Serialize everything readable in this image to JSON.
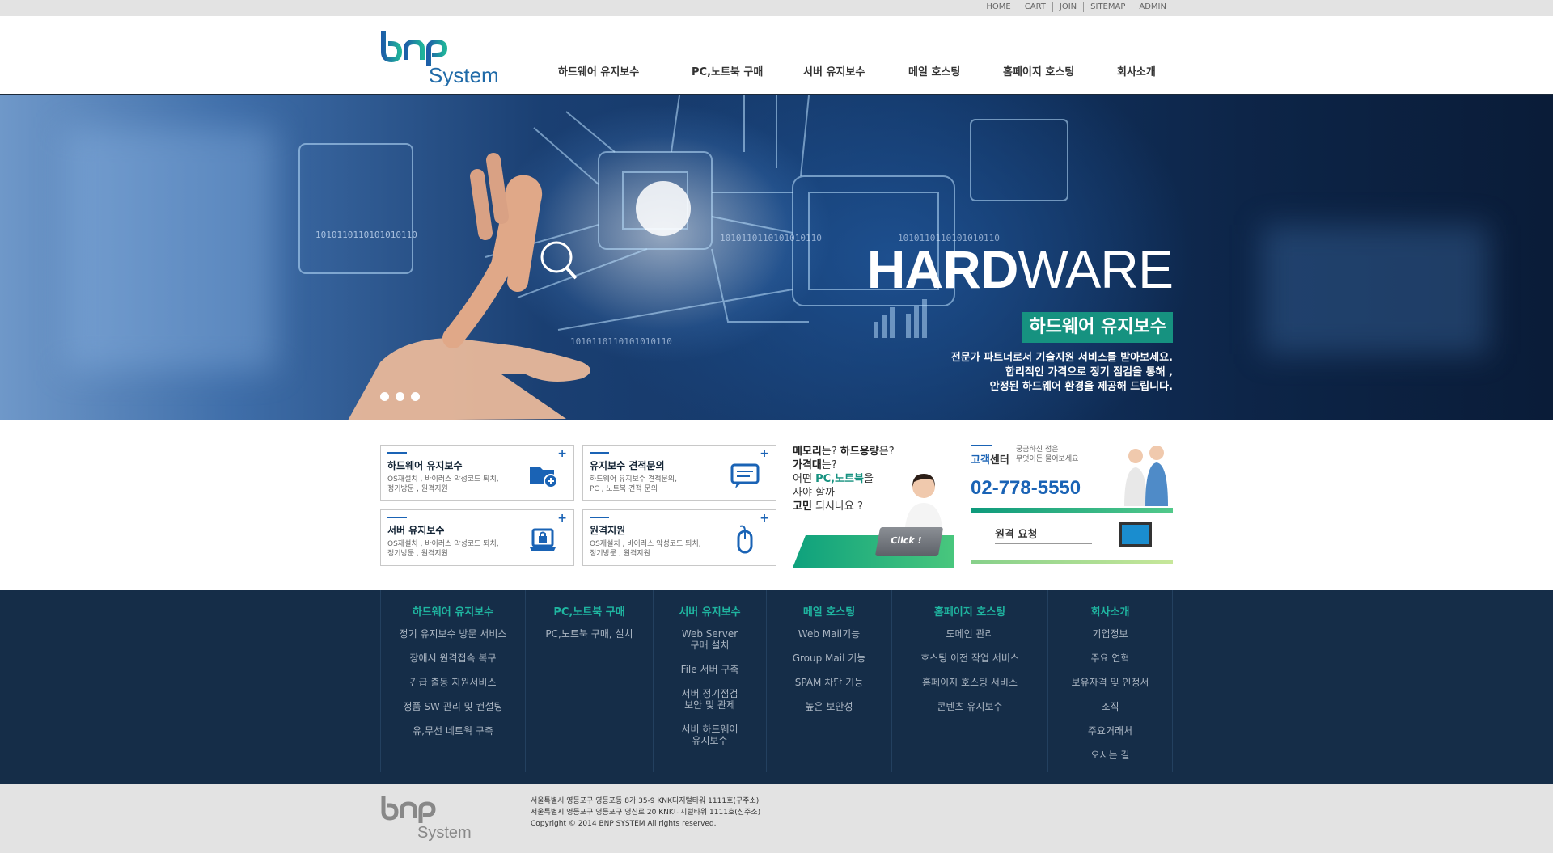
{
  "top_links": [
    "HOME",
    "CART",
    "JOIN",
    "SITEMAP",
    "ADMIN"
  ],
  "nav": [
    "하드웨어 유지보수",
    "PC,노트북 구매",
    "서버 유지보수",
    "메일 호스팅",
    "홈페이지 호스팅",
    "회사소개"
  ],
  "logo": {
    "brand": "System"
  },
  "hero": {
    "headline_bold": "HARD",
    "headline_light": "WARE",
    "badge": "하드웨어 유지보수",
    "lines": [
      "전문가 파트너로서 기술지원 서비스를 받아보세요.",
      "합리적인 가격으로 정기 점검을 통해 ,",
      "안정된 하드웨어 환경을 제공해 드립니다."
    ],
    "binary": "1010110110101010110"
  },
  "cards": [
    {
      "title": "하드웨어 유지보수",
      "desc1": "OS재설치 , 바이러스 악성코드 퇴치,",
      "desc2": "정기방문 , 원격지원",
      "icon": "folder-plus-icon"
    },
    {
      "title": "유지보수 견적문의",
      "desc1": "하드웨어 유지보수 견적문의,",
      "desc2": "PC , 노트북 견적 문의",
      "icon": "mail-icon"
    },
    {
      "title": "서버 유지보수",
      "desc1": "OS재설치 , 바이러스 악성코드 퇴치,",
      "desc2": "정기방문 , 원격지원",
      "icon": "laptop-lock-icon"
    },
    {
      "title": "원격지원",
      "desc1": "OS재설치 , 바이러스 악성코드 퇴치,",
      "desc2": "정기방문 , 원격지원",
      "icon": "mouse-icon"
    }
  ],
  "plus": "+",
  "promo": {
    "l1a": "메모리",
    "l1b": "는? ",
    "l1c": "하드용량",
    "l1d": "은?",
    "l2a": "가격대",
    "l2b": "는?",
    "l3a": "어떤 ",
    "l3b": "PC,노트북",
    "l3c": "을",
    "l4": "사야 할까",
    "l5a": "고민",
    "l5b": " 되시나요 ?",
    "button": "Click !"
  },
  "center": {
    "label_a": "고객",
    "label_b": "센터",
    "note1": "궁금하신 점은",
    "note2": "무엇이든 물어보세요",
    "phone": "02-778-5550",
    "remote": "원격 요청"
  },
  "footer_nav": [
    {
      "heading": "하드웨어 유지보수",
      "items": [
        "정기 유지보수 방문 서비스",
        "장애시 원격접속 복구",
        "긴급 출동 지원서비스",
        "정품 SW 관리 및 컨설팅",
        "유,무선 네트웍 구축"
      ]
    },
    {
      "heading": "PC,노트북 구매",
      "items": [
        "PC,노트북 구매, 설치"
      ]
    },
    {
      "heading": "서버 유지보수",
      "items": [
        "Web Server\n구매 설치",
        "File 서버 구축",
        "서버 정기점검\n보안 및 관제",
        "서버 하드웨어\n유지보수"
      ]
    },
    {
      "heading": "메일 호스팅",
      "items": [
        "Web Mail기능",
        "Group Mail 기능",
        "SPAM 차단 기능",
        "높은 보안성"
      ]
    },
    {
      "heading": "홈페이지 호스팅",
      "items": [
        "도메인 관리",
        "호스팅 이전 작업 서비스",
        "홈페이지 호스팅 서비스",
        "콘텐츠 유지보수"
      ]
    },
    {
      "heading": "회사소개",
      "items": [
        "기업정보",
        "주요 연혁",
        "보유자격 및 인정서",
        "조직",
        "주요거래처",
        "오시는 길"
      ]
    }
  ],
  "address": [
    "서울특별시 영등포구 영등포동 8가 35-9 KNK디지털타워 1111호(구주소)",
    "서울특별시 영등포구 영등포구 영신로 20 KNK디지털타워 1111호(신주소)",
    "Copyright © 2014 BNP SYSTEM All rights reserved."
  ],
  "colors": {
    "accent": "#1a63b5",
    "teal": "#169280",
    "footer_bg": "#152d48"
  }
}
